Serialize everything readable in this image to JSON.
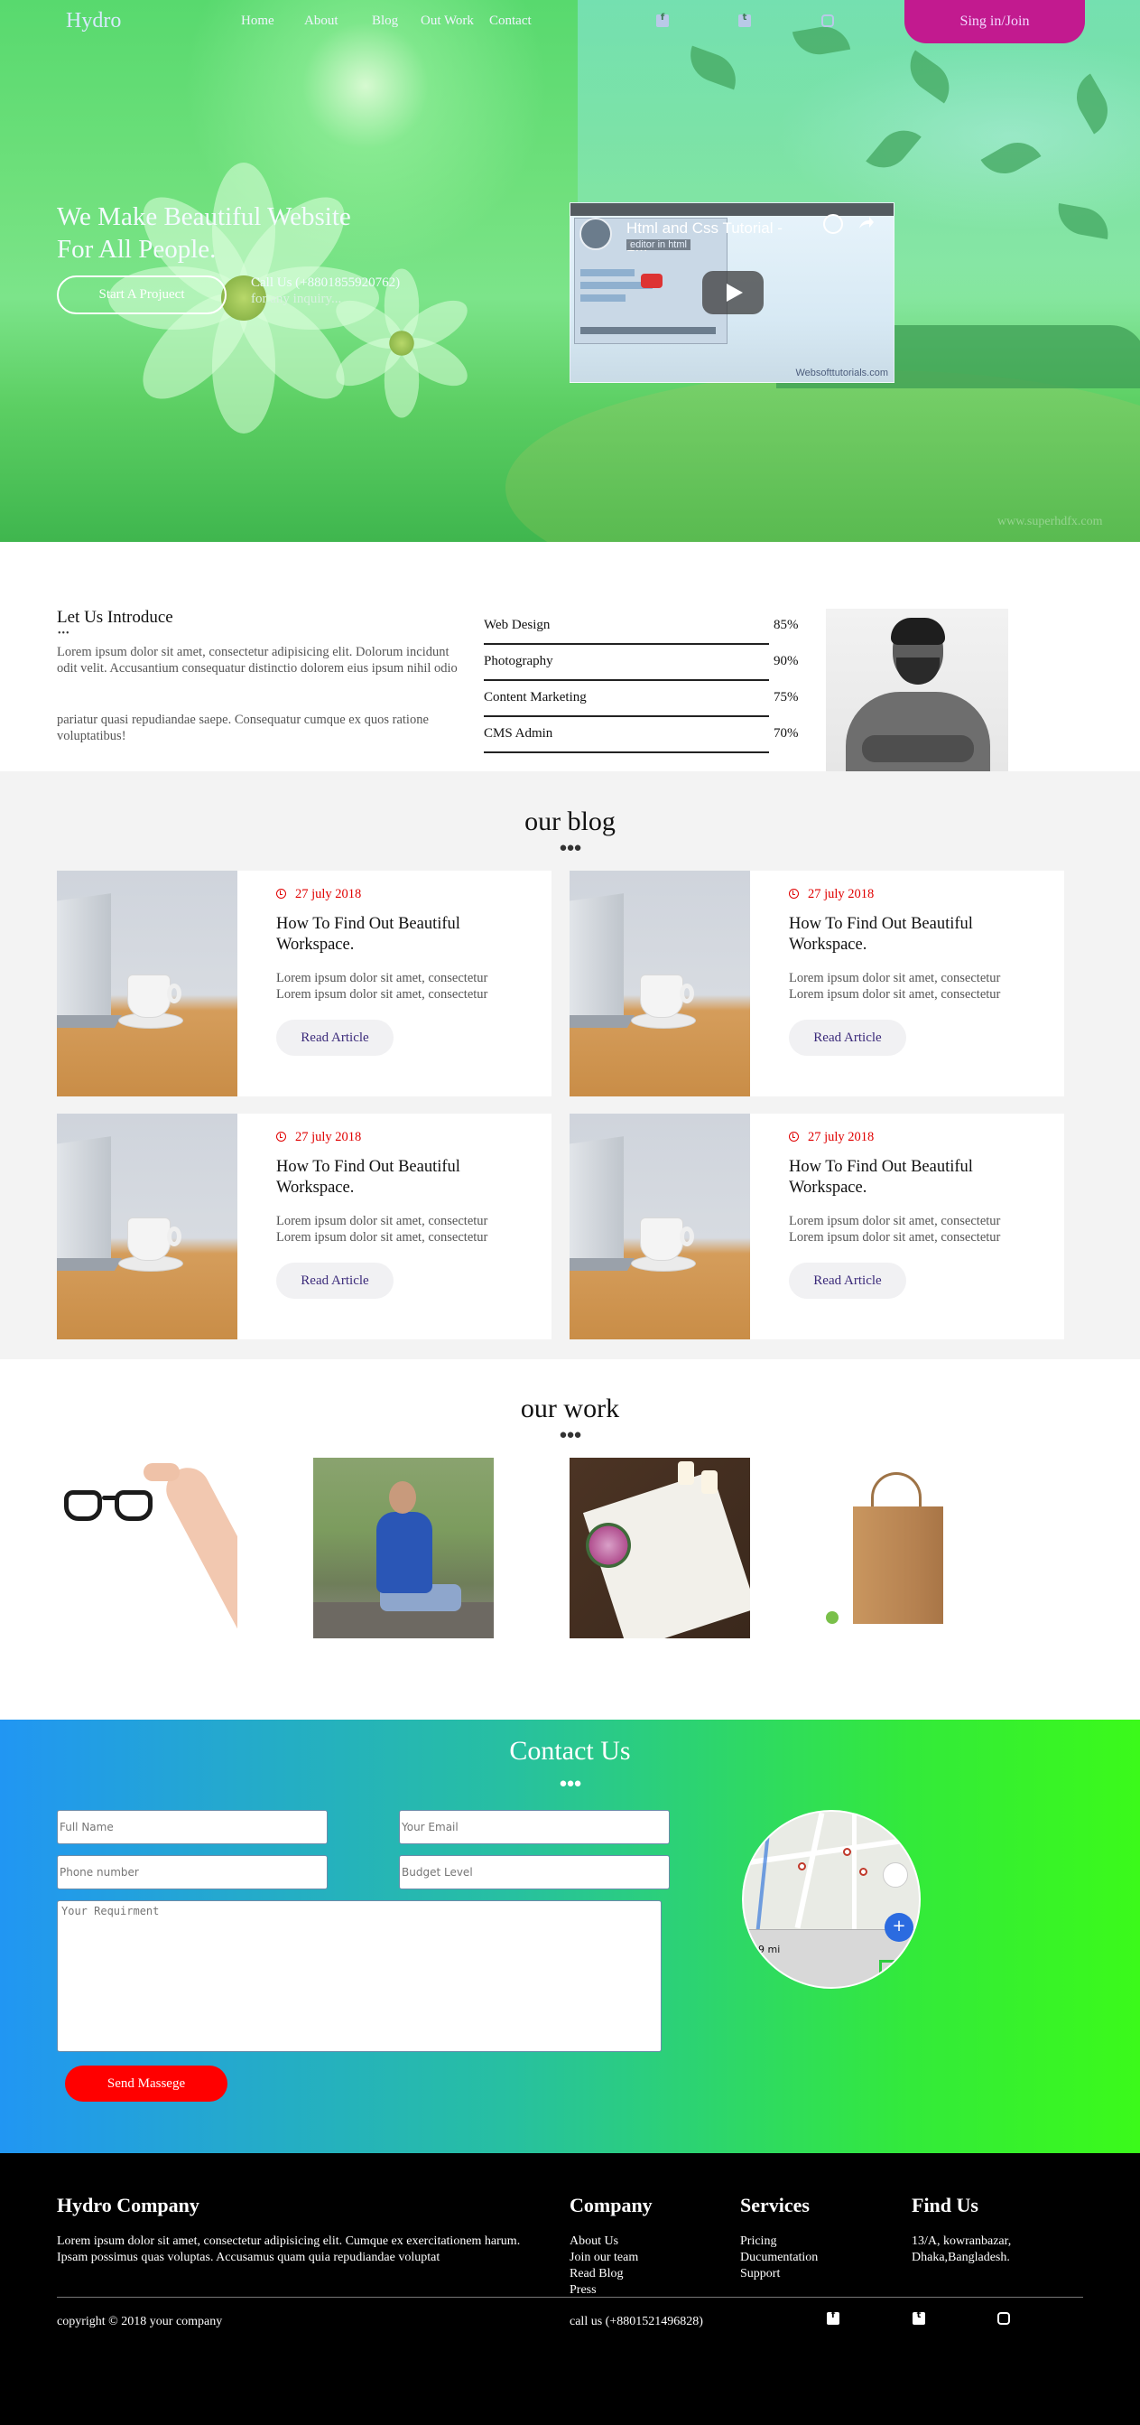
{
  "nav": {
    "logo": "Hydro",
    "links": [
      "Home",
      "About",
      "Blog",
      "Out Work",
      "Contact"
    ],
    "social_icons": [
      "facebook-icon",
      "twitter-icon",
      "instagram-icon"
    ],
    "signin_label": "Sing in/Join"
  },
  "hero": {
    "title": "We Make Beautiful Website For All People.",
    "button_label": "Start A Projuect",
    "call_line": "Call Us (+8801855920762)",
    "call_sub": "for any inquiry...",
    "watermark": "www.superhdfx.com",
    "video": {
      "title": "Html and Css Tutorial - 1...",
      "subtitle": "editor in html",
      "channel": "Websofttutorials.com",
      "play_icon": "play-icon"
    }
  },
  "intro": {
    "title": "Let Us Introduce",
    "dots": "•••",
    "paragraph1": "Lorem ipsum dolor sit amet, consectetur adipisicing elit. Dolorum incidunt odit velit. Accusantium consequatur distinctio dolorem eius ipsum nihil odio",
    "paragraph2": "pariatur quasi repudiandae saepe. Consequatur cumque ex quos ratione voluptatibus!",
    "skills": [
      {
        "label": "Web Design",
        "pct": "85%"
      },
      {
        "label": "Photography",
        "pct": "90%"
      },
      {
        "label": "Content Marketing",
        "pct": "75%"
      },
      {
        "label": "CMS Admin",
        "pct": "70%"
      }
    ]
  },
  "blog": {
    "title": "our blog",
    "dots": "●●●",
    "cards": [
      {
        "date": "27 july 2018",
        "title": "How To Find Out Beautiful Workspace.",
        "line1": "Lorem ipsum dolor sit amet, consectetur",
        "line2": "Lorem ipsum dolor sit amet, consectetur",
        "button": "Read Article"
      },
      {
        "date": "27 july 2018",
        "title": "How To Find Out Beautiful Workspace.",
        "line1": "Lorem ipsum dolor sit amet, consectetur",
        "line2": "Lorem ipsum dolor sit amet, consectetur",
        "button": "Read Article"
      },
      {
        "date": "27 july 2018",
        "title": "How To Find Out Beautiful Workspace.",
        "line1": "Lorem ipsum dolor sit amet, consectetur",
        "line2": "Lorem ipsum dolor sit amet, consectetur",
        "button": "Read Article"
      },
      {
        "date": "27 july 2018",
        "title": "How To Find Out Beautiful Workspace.",
        "line1": "Lorem ipsum dolor sit amet, consectetur",
        "line2": "Lorem ipsum dolor sit amet, consectetur",
        "button": "Read Article"
      }
    ]
  },
  "work": {
    "title": "our work",
    "dots": "●●●"
  },
  "contact": {
    "title": "Contact Us",
    "dots": "●●●",
    "full_name_placeholder": "Full Name",
    "email_placeholder": "Your Email",
    "phone_placeholder": "Phone number",
    "budget_placeholder": "Budget Level",
    "requirement_placeholder": "Your Requirment",
    "send_label": "Send Massege",
    "map_scale": "9 mi",
    "map_zoom_label": "+"
  },
  "footer": {
    "company_title": "Hydro Company",
    "company_text": "Lorem ipsum dolor sit amet, consectetur adipisicing elit. Cumque ex exercitationem harum. Ipsam possimus quas voluptas. Accusamus quam quia repudiandae voluptat",
    "col_company_title": "Company",
    "col_company_items": [
      "About Us",
      "Join our team",
      "Read Blog",
      "Press"
    ],
    "col_services_title": "Services",
    "col_services_items": [
      "Pricing",
      "Ducumentation",
      "Support"
    ],
    "col_find_title": "Find Us",
    "address": "13/A, kowranbazar, Dhaka,Bangladesh.",
    "copyright": "copyright © 2018 your company",
    "call": "call us (+8801521496828)",
    "social_icons": [
      "facebook-icon",
      "twitter-icon",
      "instagram-icon"
    ]
  },
  "colors": {
    "signin": "#c21a8f",
    "send_button": "#ff0000",
    "date_red": "#e00000",
    "read_article_text": "#3b2a7a",
    "contact_gradient": [
      "#2196f3",
      "#3bfa1a"
    ],
    "footer_bg": "#000000"
  }
}
